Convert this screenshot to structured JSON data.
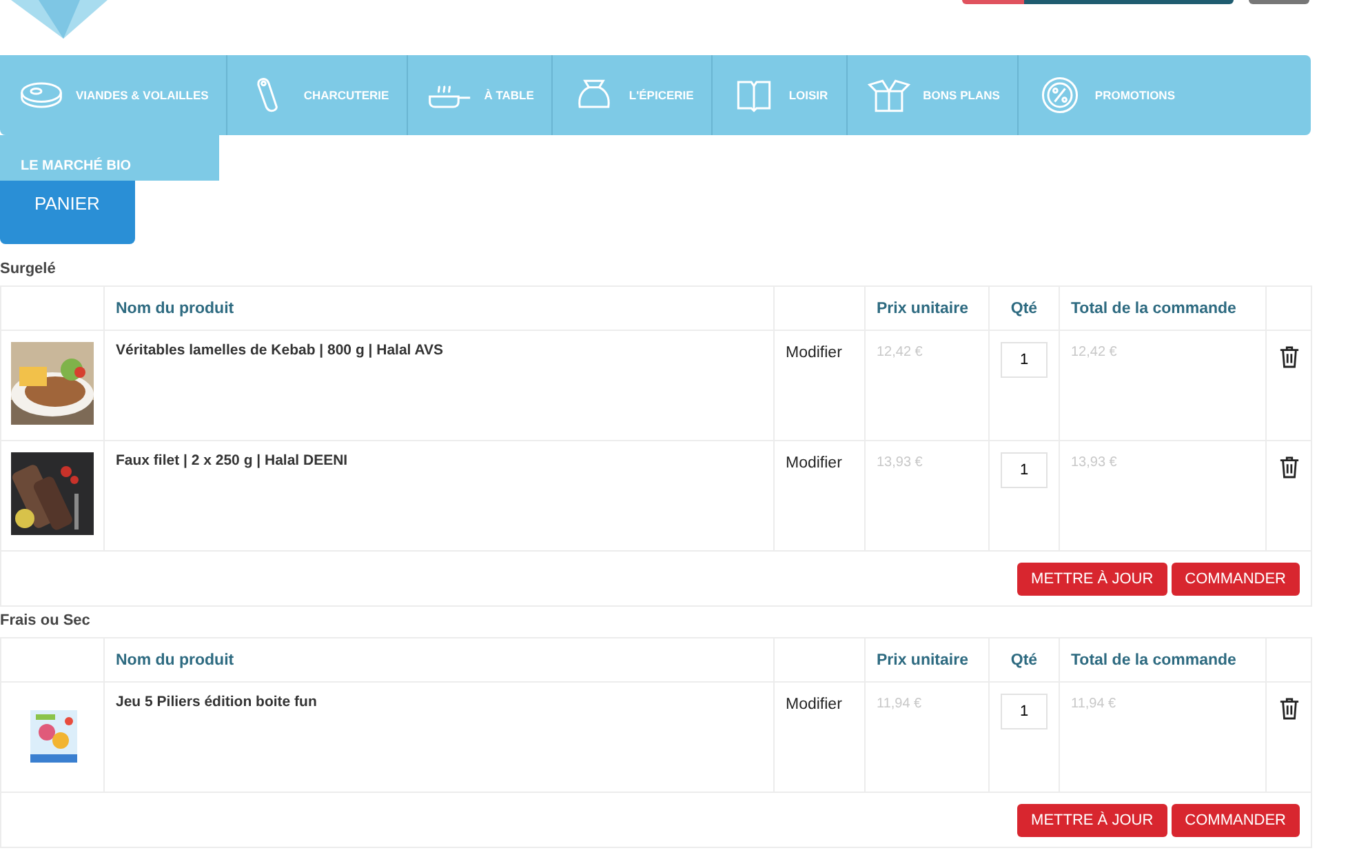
{
  "nav": {
    "items": [
      {
        "label": "VIANDES & VOLAILLES"
      },
      {
        "label": "CHARCUTERIE"
      },
      {
        "label": "À TABLE"
      },
      {
        "label": "L'ÉPICERIE"
      },
      {
        "label": "LOISIR"
      },
      {
        "label": "BONS PLANS"
      },
      {
        "label": "PROMOTIONS"
      }
    ],
    "extra_item": "LE MARCHÉ BIO"
  },
  "tab": "PANIER",
  "sections": [
    {
      "title": "Surgelé",
      "columns": [
        "Nom du produit",
        "Prix unitaire",
        "Qté",
        "Total de la commande"
      ],
      "rows": [
        {
          "name": "Véritables lamelles de Kebab | 800 g | Halal AVS",
          "action": "Modifier",
          "unit_price": "12,42 €",
          "quantity": "1",
          "total": "12,42 €"
        },
        {
          "name": "Faux filet | 2 x 250 g | Halal DEENI",
          "action": "Modifier",
          "unit_price": "13,93 €",
          "quantity": "1",
          "total": "13,93 €"
        }
      ],
      "buttons": [
        "METTRE À JOUR",
        "COMMANDER"
      ]
    },
    {
      "title": "Frais ou Sec",
      "columns": [
        "Nom du produit",
        "Prix unitaire",
        "Qté",
        "Total de la commande"
      ],
      "rows": [
        {
          "name": "Jeu 5 Piliers édition boite fun",
          "action": "Modifier",
          "unit_price": "11,94 €",
          "quantity": "1",
          "total": "11,94 €"
        }
      ],
      "buttons": [
        "METTRE À JOUR",
        "COMMANDER"
      ]
    }
  ]
}
